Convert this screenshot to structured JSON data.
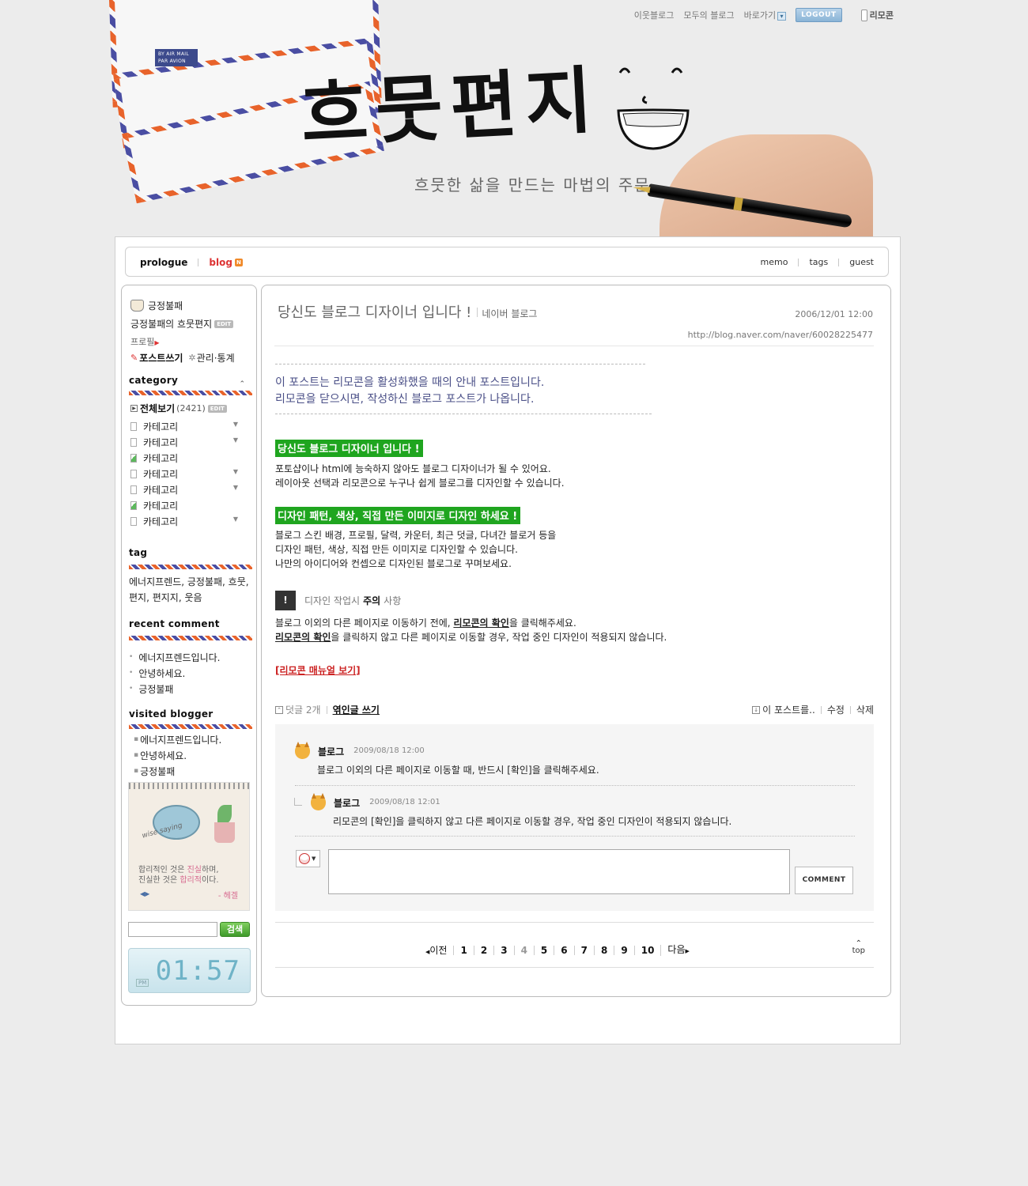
{
  "topnav": {
    "neighbor_blog": "이웃블로그",
    "everyone_blog": "모두의 블로그",
    "goto": "바로가기",
    "logout": "LOGOUT",
    "remocon": "리모콘"
  },
  "header": {
    "title": "흐뭇편지",
    "subtitle": "흐뭇한 삶을 만드는 마법의 주문",
    "airmail": "BY AIR MAIL\nPAR AVION"
  },
  "menubar": {
    "prologue": "prologue",
    "blog": "blog",
    "blog_badge": "N",
    "memo": "memo",
    "tags": "tags",
    "guest": "guest"
  },
  "sidebar": {
    "profile_name": "긍정불패",
    "blog_name": "긍정불패의 흐뭇편지",
    "edit": "EDIT",
    "profile": "프로필",
    "write_post": "포스트쓰기",
    "admin_stats": "관리·통계",
    "category_title": "category",
    "all_view": "전체보기",
    "all_count": "(2421)",
    "categories": [
      {
        "label": "카테고리",
        "icon": "doc",
        "arrow": true
      },
      {
        "label": "카테고리",
        "icon": "doc",
        "arrow": true
      },
      {
        "label": "카테고리",
        "icon": "image",
        "arrow": false
      },
      {
        "label": "카테고리",
        "icon": "doc",
        "arrow": true
      },
      {
        "label": "카테고리",
        "icon": "doc",
        "arrow": true
      },
      {
        "label": "카테고리",
        "icon": "image",
        "arrow": false
      },
      {
        "label": "카테고리",
        "icon": "doc",
        "arrow": true
      }
    ],
    "tag_title": "tag",
    "tags": "에너지프렌드, 긍정불패, 흐뭇, 편지, 편지지, 웃음",
    "recent_comment_title": "recent comment",
    "recent_comments": [
      "에너지프렌드입니다.",
      "안녕하세요.",
      "긍정불패"
    ],
    "visited_blogger_title": "visited blogger",
    "visited_bloggers": [
      "에너지프렌드입니다.",
      "안녕하세요.",
      "긍정불패"
    ],
    "wise_saying": "wise saying",
    "quote_line1_a": "합리적인 것은 ",
    "quote_line1_b": "진실",
    "quote_line1_c": "하며,",
    "quote_line2_a": "진실한 것은 ",
    "quote_line2_b": "합리적",
    "quote_line2_c": "이다.",
    "quote_author": "- 헤겔",
    "search_button": "검색",
    "clock_time": "01:57",
    "clock_ampm": "PM"
  },
  "post": {
    "title": "당신도 블로그 디자이너 입니다 !",
    "category": "네이버 블로그",
    "date": "2006/12/01 12:00",
    "url": "http://blog.naver.com/naver/60028225477",
    "notice_line1": "이 포스트는 리모콘을 활성화했을 때의 안내 포스트입니다.",
    "notice_line2": "리모콘을 닫으시면, 작성하신 블로그 포스트가 나옵니다.",
    "heading1": "당신도 블로그 디자이너 입니다 !",
    "para1_line1": "포토샵이나 html에 능숙하지 않아도 블로그 디자이너가 될 수 있어요.",
    "para1_line2": "레이아웃 선택과 리모콘으로 누구나 쉽게 블로그를 디자인할 수 있습니다.",
    "heading2": "디자인 패턴, 색상, 직접 만든 이미지로 디자인 하세요 !",
    "para2_line1": "블로그 스킨 배경, 프로필, 달력, 카운터, 최근 덧글, 다녀간 블로거 등을",
    "para2_line2": "디자인 패턴, 색상, 직접 만든 이미지로 디자인할 수 있습니다.",
    "para2_line3": "나만의 아이디어와 컨셉으로 디자인된 블로그로 꾸며보세요.",
    "warn_a": "디자인 작업시",
    "warn_b": "주의",
    "warn_c": "사항",
    "warn_icon": "!",
    "para3_line1_a": "블로그 이외의 다른 페이지로 이동하기 전에, ",
    "para3_line1_b": "리모콘의 확인",
    "para3_line1_c": "을 클릭해주세요.",
    "para3_line2_a": "리모콘의 확인",
    "para3_line2_b": "을 클릭하지 않고 다른 페이지로 이동할 경우, 작업 중인 디자인이 적용되지 않습니다.",
    "manual_link": "[리모콘 매뉴얼 보기]"
  },
  "reply_bar": {
    "comment_count": "덧글 2개",
    "trackback": "엮인글 쓰기",
    "this_post": "이 포스트를..",
    "edit": "수정",
    "delete": "삭제"
  },
  "comments": [
    {
      "author": "블로그",
      "date": "2009/08/18 12:00",
      "text": "블로그 이외의 다른 페이지로 이동할 때, 반드시 [확인]을 클릭해주세요."
    },
    {
      "author": "블로그",
      "date": "2009/08/18 12:01",
      "text": "리모콘의 [확인]을 클릭하지 않고 다른 페이지로 이동할 경우, 작업 중인 디자인이 적용되지 않습니다."
    }
  ],
  "comment_button": "COMMENT",
  "pager": {
    "prev": "이전",
    "pages": [
      "1",
      "2",
      "3",
      "4",
      "5",
      "6",
      "7",
      "8",
      "9",
      "10"
    ],
    "current": "4",
    "next": "다음",
    "top": "top"
  }
}
